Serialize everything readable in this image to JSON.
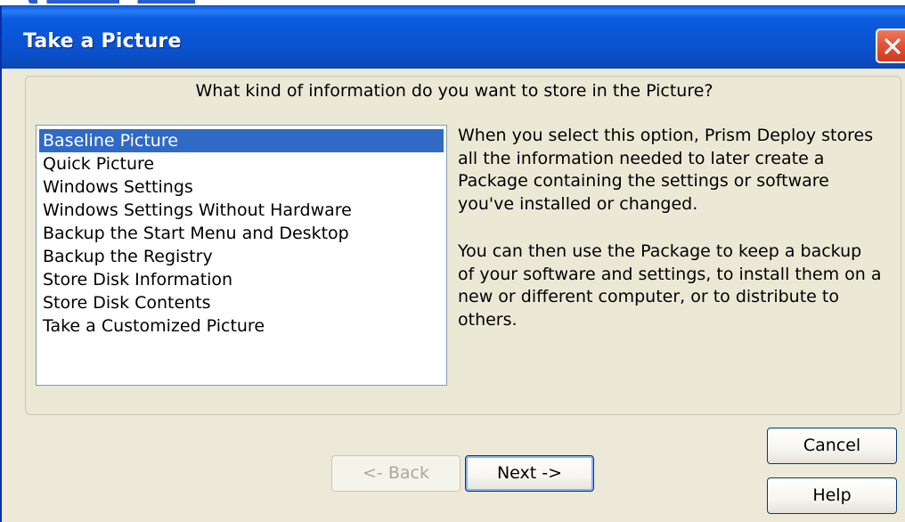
{
  "window": {
    "title": "Take a Picture"
  },
  "question": "What kind of information do you want to store in the Picture?",
  "options": [
    {
      "label": "Baseline Picture",
      "selected": true
    },
    {
      "label": "Quick Picture",
      "selected": false
    },
    {
      "label": "Windows Settings",
      "selected": false
    },
    {
      "label": "Windows Settings Without Hardware",
      "selected": false
    },
    {
      "label": "Backup the Start Menu and Desktop",
      "selected": false
    },
    {
      "label": "Backup the Registry",
      "selected": false
    },
    {
      "label": "Store Disk Information",
      "selected": false
    },
    {
      "label": "Store Disk Contents",
      "selected": false
    },
    {
      "label": "Take a Customized Picture",
      "selected": false
    }
  ],
  "description": {
    "lines": [
      "When you select this option, Prism Deploy stores",
      "all the information needed to later create a",
      "Package containing the settings or software",
      "you've installed or changed.",
      "",
      "You can then use the Package to keep a backup",
      "of your software and settings, to install them on a",
      "new or different computer, or to distribute to",
      "others."
    ]
  },
  "buttons": {
    "back": "<- Back",
    "next": "Next ->",
    "cancel": "Cancel",
    "help": "Help"
  },
  "colors": {
    "titlebar": "#0a54d3",
    "selection": "#316ac5",
    "close": "#e2533a",
    "dialog_bg": "#ece9d8"
  }
}
